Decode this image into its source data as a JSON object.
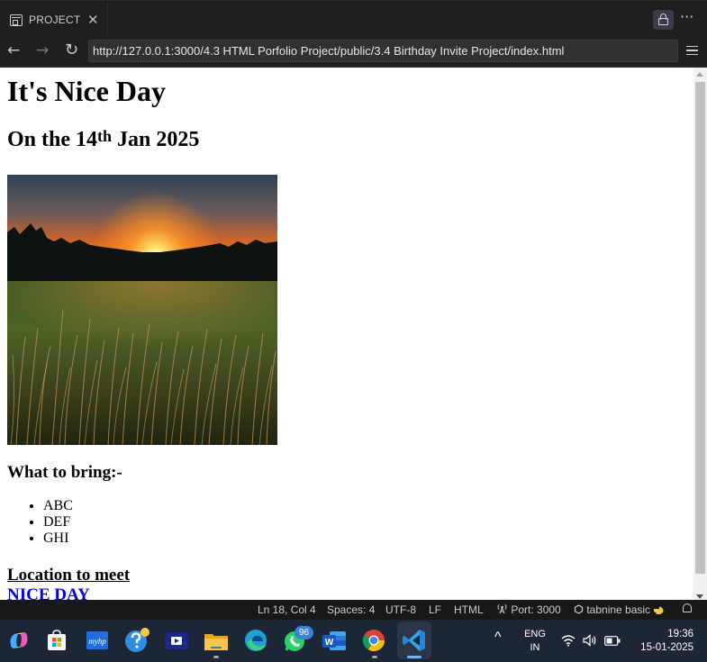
{
  "tab": {
    "title": "PROJECT",
    "close_glyph": "✕"
  },
  "window": {
    "more_glyph": "···"
  },
  "nav": {
    "back_glyph": "←",
    "forward_glyph": "→",
    "reload_glyph": "↻",
    "url": "http://127.0.0.1:3000/4.3 HTML Porfolio Project/public/3.4 Birthday Invite Project/index.html"
  },
  "page": {
    "title": "It's Nice Day",
    "date_prefix": "On the 14",
    "date_sup": "th",
    "date_suffix": " Jan 2025",
    "image_subject": "sunset over grass field",
    "bring_heading": "What to bring:-",
    "bring_items": [
      "ABC",
      "DEF",
      "GHI"
    ],
    "location_heading": "Location to meet",
    "location_link": "NICE DAY"
  },
  "statusbar": {
    "position": "Ln 18, Col 4",
    "spaces": "Spaces: 4",
    "encoding": "UTF-8",
    "eol": "LF",
    "language": "HTML",
    "port": "Port: 3000",
    "tabnine": "tabnine basic"
  },
  "taskbar": {
    "apps": [
      "copilot-icon",
      "store-icon",
      "myhp-icon",
      "help-icon",
      "media-icon",
      "file-explorer-icon",
      "edge-icon",
      "whatsapp-icon",
      "word-icon",
      "chrome-icon",
      "vscode-icon"
    ],
    "whatsapp_badge": "96",
    "myhp_label": "myhp",
    "word_letter": "W",
    "tray_chevron": "^",
    "lang_line1": "ENG",
    "lang_line2": "IN",
    "time": "19:36",
    "date": "15-01-2025"
  },
  "colors": {
    "link": "#0000ee",
    "taskbar": "#1c2637",
    "accent": "#6fb6ff"
  }
}
